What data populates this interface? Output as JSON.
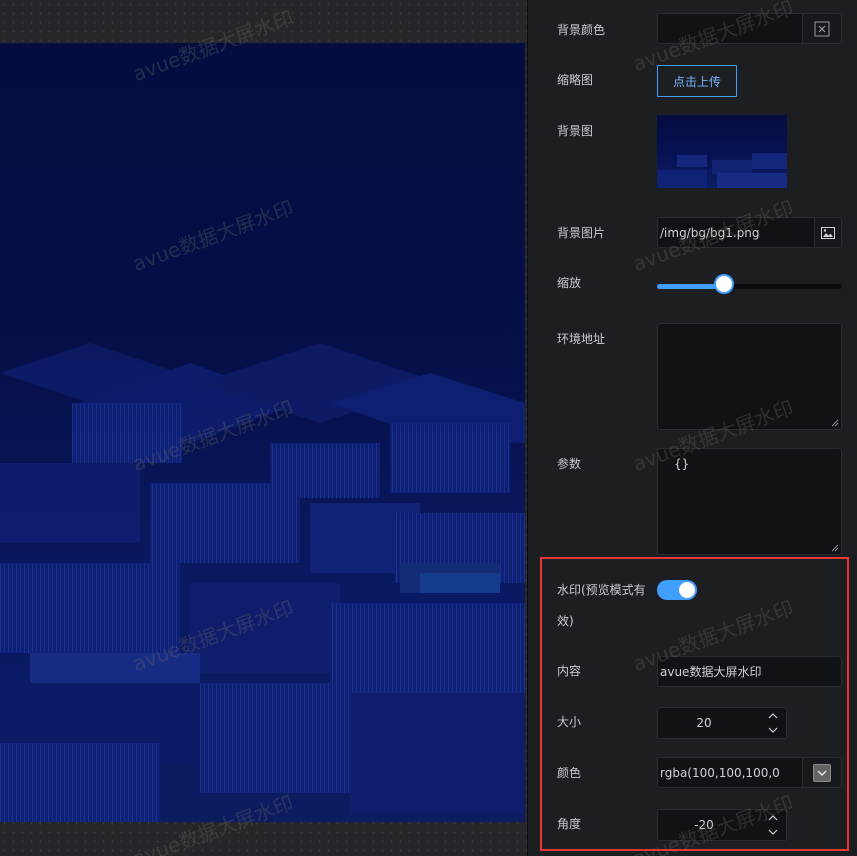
{
  "watermark": {
    "text": "avue数据大屏水印"
  },
  "panel": {
    "bg_color": {
      "label": "背景颜色",
      "value": ""
    },
    "thumbnail": {
      "label": "缩略图",
      "button": "点击上传"
    },
    "bg_image": {
      "label": "背景图"
    },
    "bg_picture": {
      "label": "背景图片",
      "value": "/img/bg/bg1.png"
    },
    "zoom": {
      "label": "缩放",
      "value": 0.36
    },
    "env_address": {
      "label": "环境地址",
      "value": ""
    },
    "params": {
      "label": "参数",
      "value": "{}"
    },
    "watermark_toggle": {
      "label_line1": "水印(预览模式有",
      "label_line2": "效)",
      "enabled": true
    },
    "wm_content": {
      "label": "内容",
      "value": "avue数据大屏水印"
    },
    "wm_size": {
      "label": "大小",
      "value": "20"
    },
    "wm_color": {
      "label": "颜色",
      "value": "rgba(100,100,100,0",
      "swatch": "#646464"
    },
    "wm_angle": {
      "label": "角度",
      "value": "-20"
    }
  },
  "colors": {
    "accent": "#409eff",
    "highlight": "#e53935"
  }
}
